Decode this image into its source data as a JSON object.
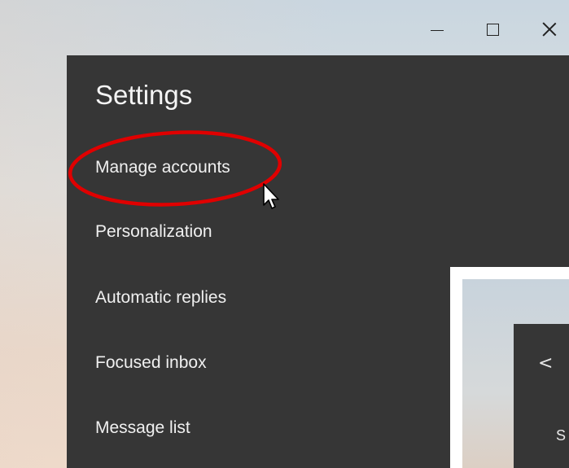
{
  "window": {
    "minimize_label": "Minimize",
    "maximize_label": "Maximize",
    "close_label": "Close"
  },
  "settings": {
    "title": "Settings",
    "items": [
      {
        "label": "Manage accounts"
      },
      {
        "label": "Personalization"
      },
      {
        "label": "Automatic replies"
      },
      {
        "label": "Focused inbox"
      },
      {
        "label": "Message list"
      }
    ]
  },
  "annotation": {
    "highlight_color": "#e00000"
  },
  "inset": {
    "back_glyph": "<",
    "partial_text": "S"
  }
}
